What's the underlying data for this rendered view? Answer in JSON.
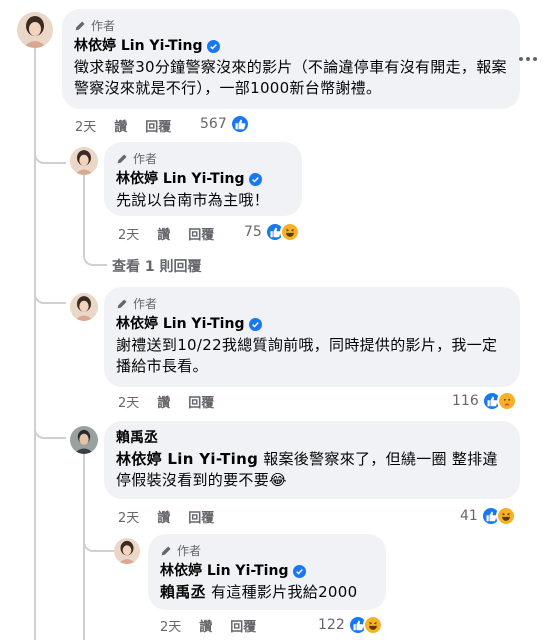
{
  "comments": [
    {
      "author_tag": "作者",
      "name": "林依婷 Lin Yi-Ting",
      "verified": true,
      "text": "徵求報警30分鐘警察沒來的影片（不論違停車有沒有開走，報案警察沒來就是不行），一部1000新台幣謝禮。",
      "time": "2天",
      "like_label": "讚",
      "reply_label": "回覆",
      "reaction_count": "567",
      "reactions": [
        "like-icon"
      ]
    },
    {
      "author_tag": "作者",
      "name": "林依婷 Lin Yi-Ting",
      "verified": true,
      "text": "先說以台南市為主哦！",
      "time": "2天",
      "like_label": "讚",
      "reply_label": "回覆",
      "reaction_count": "75",
      "reactions": [
        "like-icon",
        "haha-icon"
      ]
    },
    {
      "author_tag": "作者",
      "name": "林依婷 Lin Yi-Ting",
      "verified": true,
      "text": "謝禮送到10/22我總質詢前哦，同時提供的影片，我一定播給市長看。",
      "time": "2天",
      "like_label": "讚",
      "reply_label": "回覆",
      "reaction_count": "116",
      "reactions": [
        "like-icon",
        "care-icon"
      ]
    },
    {
      "name": "賴禹丞",
      "verified": false,
      "mention": "林依婷 Lin Yi-Ting",
      "text": " 報案後警察來了，但繞一圈 整排違停假裝沒看到的要不要😂",
      "time": "2天",
      "like_label": "讚",
      "reply_label": "回覆",
      "reaction_count": "41",
      "reactions": [
        "like-icon",
        "haha-icon"
      ]
    },
    {
      "author_tag": "作者",
      "name": "林依婷 Lin Yi-Ting",
      "verified": true,
      "mention": "賴禹丞",
      "text": " 有這種影片我給2000",
      "time": "2天",
      "like_label": "讚",
      "reply_label": "回覆",
      "reaction_count": "122",
      "reactions": [
        "like-icon",
        "haha-icon"
      ]
    }
  ],
  "view_more_replies": "查看 1 則回覆",
  "colors": {
    "bubble": "#f0f2f5",
    "like_blue": "#1877f2",
    "verified_blue": "#1877f2",
    "secondary_text": "#65676b",
    "haha_yellow": "#f7b125"
  }
}
